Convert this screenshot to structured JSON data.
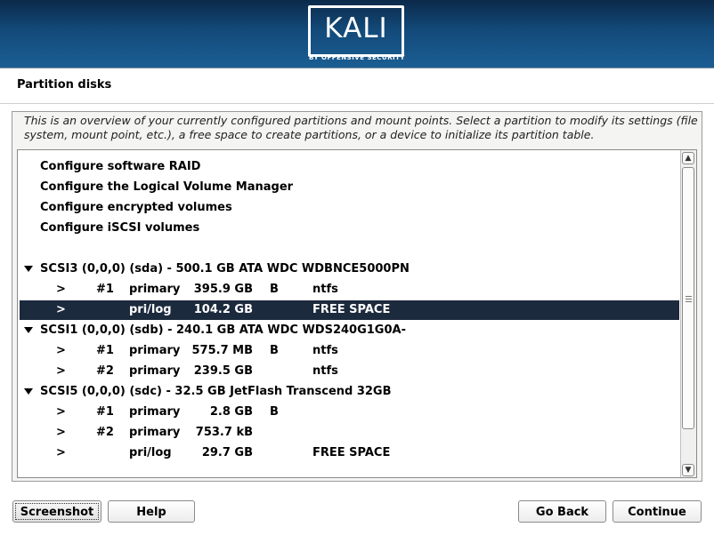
{
  "header": {
    "logo_text": "KALI",
    "logo_subtitle": "BY OFFENSIVE SECURITY"
  },
  "page": {
    "title": "Partition disks",
    "description": "This is an overview of your currently configured partitions and mount points. Select a partition to modify its settings (file system, mount point, etc.), a free space to create partitions, or a device to initialize its partition table."
  },
  "list": {
    "options": [
      "Configure software RAID",
      "Configure the Logical Volume Manager",
      "Configure encrypted volumes",
      "Configure iSCSI volumes"
    ],
    "disks": [
      {
        "label": "SCSI3 (0,0,0) (sda) - 500.1 GB ATA WDC WDBNCE5000PN",
        "partitions": [
          {
            "arrow": ">",
            "num": "#1",
            "type": "primary",
            "size": "395.9 GB",
            "flag": "B",
            "fs": "ntfs"
          },
          {
            "arrow": ">",
            "num": "",
            "type": "pri/log",
            "size": "104.2 GB",
            "flag": "",
            "fs": "FREE SPACE"
          }
        ]
      },
      {
        "label": "SCSI1 (0,0,0) (sdb) - 240.1 GB ATA WDC WDS240G1G0A-",
        "partitions": [
          {
            "arrow": ">",
            "num": "#1",
            "type": "primary",
            "size": "575.7 MB",
            "flag": "B",
            "fs": "ntfs"
          },
          {
            "arrow": ">",
            "num": "#2",
            "type": "primary",
            "size": "239.5 GB",
            "flag": "",
            "fs": "ntfs"
          }
        ]
      },
      {
        "label": "SCSI5 (0,0,0) (sdc) - 32.5 GB JetFlash Transcend 32GB",
        "partitions": [
          {
            "arrow": ">",
            "num": "#1",
            "type": "primary",
            "size": "2.8 GB",
            "flag": "B",
            "fs": ""
          },
          {
            "arrow": ">",
            "num": "#2",
            "type": "primary",
            "size": "753.7 kB",
            "flag": "",
            "fs": ""
          },
          {
            "arrow": ">",
            "num": "",
            "type": "pri/log",
            "size": "29.7 GB",
            "flag": "",
            "fs": "FREE SPACE"
          }
        ]
      }
    ]
  },
  "buttons": {
    "screenshot": "Screenshot",
    "help": "Help",
    "go_back": "Go Back",
    "continue": "Continue"
  },
  "colors": {
    "banner": "#134a7a",
    "selection": "#1c2a3d"
  }
}
